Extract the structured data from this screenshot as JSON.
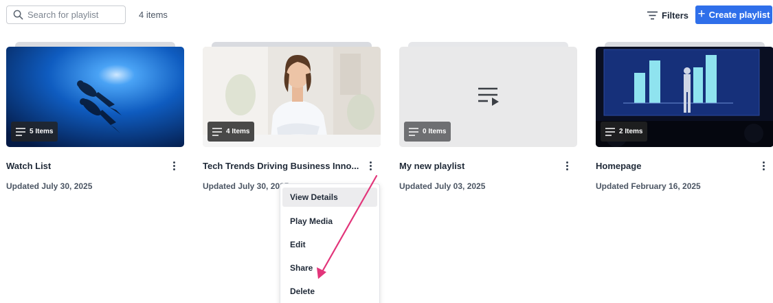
{
  "toolbar": {
    "search_placeholder": "Search for playlist",
    "item_count": "4 items",
    "filters_label": "Filters",
    "create_label": "Create playlist"
  },
  "playlists": [
    {
      "title": "Watch List",
      "updated": "Updated July 30, 2025",
      "items": "5 Items",
      "thumbnail": "underwater-divers"
    },
    {
      "title": "Tech Trends Driving Business Inno...",
      "updated": "Updated July 30, 2025",
      "items": "4 Items",
      "thumbnail": "woman-at-desk"
    },
    {
      "title": "My new playlist",
      "updated": "Updated July 03, 2025",
      "items": "0 Items",
      "thumbnail": "playlist-placeholder-icon"
    },
    {
      "title": "Homepage",
      "updated": "Updated February 16, 2025",
      "items": "2 Items",
      "thumbnail": "presenter-on-stage"
    }
  ],
  "context_menu": {
    "items": [
      "View Details",
      "Play Media",
      "Edit",
      "Share",
      "Delete"
    ],
    "highlighted": "View Details"
  },
  "annotation": {
    "color": "#e2357a"
  },
  "colors": {
    "primary": "#2f6fea",
    "menu_highlight": "#ececee"
  }
}
